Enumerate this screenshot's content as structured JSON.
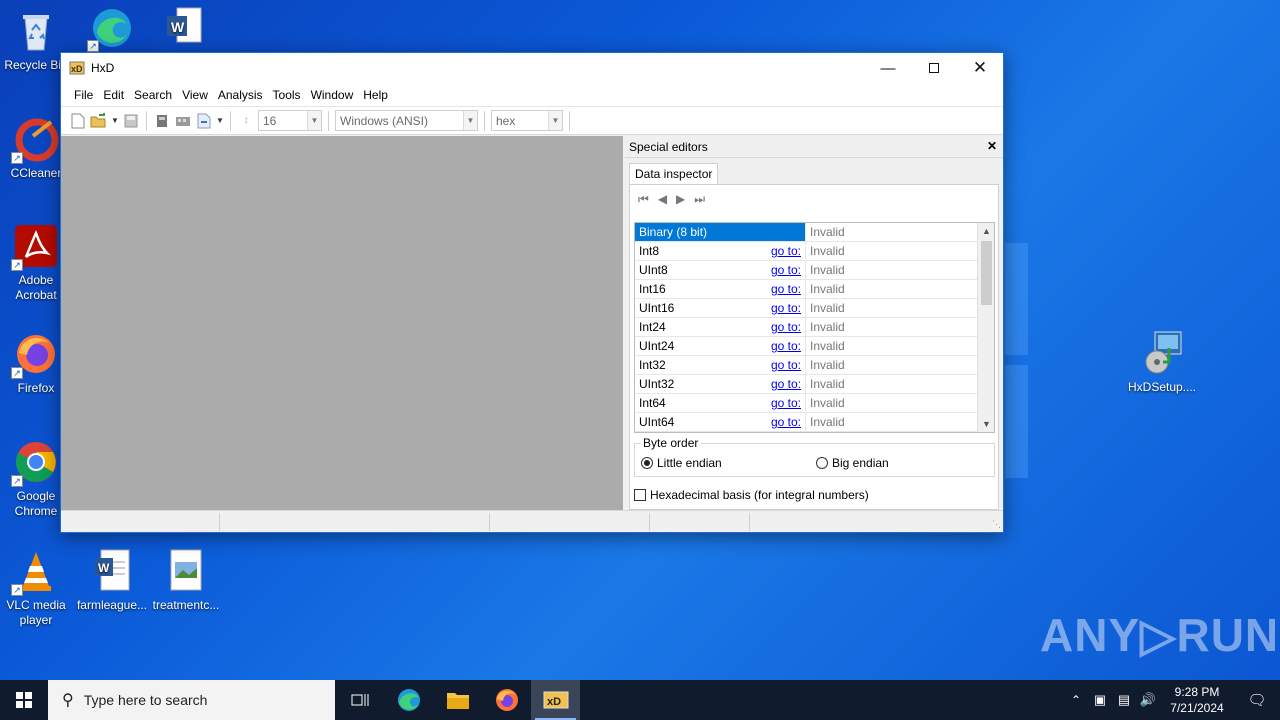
{
  "desktop": {
    "icons": [
      {
        "label": "Recycle Bin",
        "icon": "recycle-bin-icon"
      },
      {
        "label": "",
        "icon": "edge-icon"
      },
      {
        "label": "",
        "icon": "word-icon"
      },
      {
        "label": "CCleaner",
        "icon": "ccleaner-icon"
      },
      {
        "label": "Adobe Acrobat",
        "icon": "acrobat-icon"
      },
      {
        "label": "Firefox",
        "icon": "firefox-icon"
      },
      {
        "label": "Google Chrome",
        "icon": "chrome-icon"
      },
      {
        "label": "VLC media player",
        "icon": "vlc-icon"
      },
      {
        "label": "farmleague...",
        "icon": "word-doc-icon"
      },
      {
        "label": "treatmentc...",
        "icon": "image-file-icon"
      },
      {
        "label": "HxDSetup....",
        "icon": "installer-icon"
      }
    ],
    "watermark": "ANY▷RUN"
  },
  "window": {
    "title": "HxD",
    "menu": [
      "File",
      "Edit",
      "Search",
      "View",
      "Analysis",
      "Tools",
      "Window",
      "Help"
    ],
    "toolbar": {
      "bytes_per_row": "16",
      "charset": "Windows (ANSI)",
      "offset_base": "hex"
    },
    "special_editors": {
      "title": "Special editors",
      "tab": "Data inspector",
      "rows": [
        {
          "type": "Binary (8 bit)",
          "goto": "",
          "value": "Invalid",
          "selected": true
        },
        {
          "type": "Int8",
          "goto": "go to:",
          "value": "Invalid"
        },
        {
          "type": "UInt8",
          "goto": "go to:",
          "value": "Invalid"
        },
        {
          "type": "Int16",
          "goto": "go to:",
          "value": "Invalid"
        },
        {
          "type": "UInt16",
          "goto": "go to:",
          "value": "Invalid"
        },
        {
          "type": "Int24",
          "goto": "go to:",
          "value": "Invalid"
        },
        {
          "type": "UInt24",
          "goto": "go to:",
          "value": "Invalid"
        },
        {
          "type": "Int32",
          "goto": "go to:",
          "value": "Invalid"
        },
        {
          "type": "UInt32",
          "goto": "go to:",
          "value": "Invalid"
        },
        {
          "type": "Int64",
          "goto": "go to:",
          "value": "Invalid"
        },
        {
          "type": "UInt64",
          "goto": "go to:",
          "value": "Invalid"
        }
      ],
      "byte_order": {
        "legend": "Byte order",
        "little": "Little endian",
        "big": "Big endian",
        "selected": "little"
      },
      "hex_basis": "Hexadecimal basis (for integral numbers)"
    }
  },
  "taskbar": {
    "search_placeholder": "Type here to search",
    "time": "9:28 PM",
    "date": "7/21/2024"
  }
}
